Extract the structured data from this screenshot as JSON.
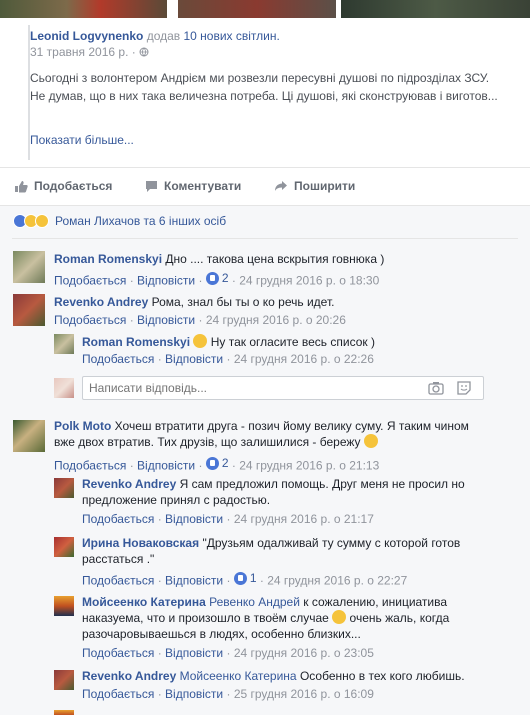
{
  "shared_post": {
    "author": "Leonid Logvynenko",
    "action": "додав",
    "photos_link": "10 нових світлин.",
    "date": "31 травня 2016 р. ·",
    "text": "Сьогодні з волонтером Андрієм ми розвезли пересувні душові по підрозділах ЗСУ. Не думав, що в них така величезна потреба. Ці душові, які сконструював і виготов...",
    "show_more": "Показати більше..."
  },
  "actions": {
    "like": "Подобається",
    "comment": "Коментувати",
    "share": "Поширити"
  },
  "reactions": {
    "text": "Роман Лихачов та 6 інших осіб"
  },
  "labels": {
    "like": "Подобається",
    "reply": "Відповісти",
    "dot": "·",
    "reply_placeholder": "Написати відповідь..."
  },
  "comments": [
    {
      "author": "Roman Romenskyi",
      "text": "Дно .... такова цена вскрытия говнюка )",
      "likes": "2",
      "time": "24 грудня 2016 р. о 18:30"
    },
    {
      "author": "Revenko Andrey",
      "text": "Рома, знал бы ты о ко речь идет.",
      "time": "24 грудня 2016 р. о 20:26",
      "replies": [
        {
          "author": "Roman Romenskyi",
          "text": "Ну так огласите весь список )",
          "time": "24 грудня 2016 р. о 22:26"
        }
      ]
    },
    {
      "author": "Polk Moto",
      "text": "Хочеш втратити друга - позич йому велику суму. Я таким чином вже двох втратив. Тих друзів, що залишилися - бережу",
      "likes": "2",
      "time": "24 грудня 2016 р. о 21:13",
      "replies": [
        {
          "author": "Revenko Andrey",
          "text": "Я сам предложил помощь. Друг меня не просил но предложение принял с радостью.",
          "time": "24 грудня 2016 р. о 21:17"
        },
        {
          "author": "Ирина Новаковская",
          "text": "\"Друзьям одалживай ту сумму с которой готов расстаться .\"",
          "likes": "1",
          "time": "24 грудня 2016 р. о 22:27"
        },
        {
          "author": "Мойсеенко Катерина",
          "mention": "Ревенко Андрей",
          "text": "к сожалению, инициатива наказуема, что и произошло в твоём случае",
          "text2": "очень жаль, когда разочаровываешься в людях, особенно близких...",
          "time": "24 грудня 2016 р. о 23:05"
        },
        {
          "author": "Revenko Andrey",
          "mention": "Мойсеенко Катерина",
          "text": "Особенно в тех кого любишь.",
          "time": "25 грудня 2016 р. о 16:09"
        }
      ]
    }
  ]
}
